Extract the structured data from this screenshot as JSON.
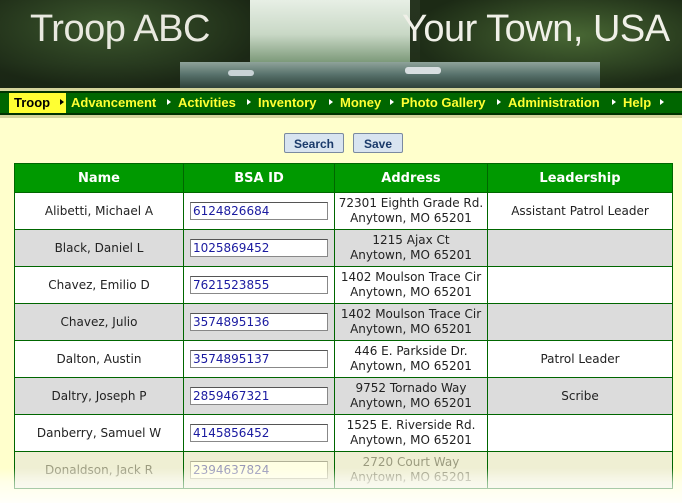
{
  "header": {
    "title_left": "Troop ABC",
    "title_right": "Your Town, USA"
  },
  "nav": {
    "items": [
      {
        "label": "Troop",
        "active": true
      },
      {
        "label": "Advancement",
        "active": false
      },
      {
        "label": "Activities",
        "active": false
      },
      {
        "label": "Inventory",
        "active": false
      },
      {
        "label": "Money",
        "active": false
      },
      {
        "label": "Photo Gallery",
        "active": false
      },
      {
        "label": "Administration",
        "active": false
      },
      {
        "label": "Help",
        "active": false
      }
    ]
  },
  "actions": {
    "search_label": "Search",
    "save_label": "Save"
  },
  "table": {
    "headers": [
      "Name",
      "BSA ID",
      "Address",
      "Leadership"
    ],
    "rows": [
      {
        "name": "Alibetti, Michael A",
        "bsa_id": "6124826684",
        "address_1": "72301 Eighth Grade Rd.",
        "address_2": "Anytown, MO 65201",
        "leadership": "Assistant Patrol Leader"
      },
      {
        "name": "Black, Daniel L",
        "bsa_id": "1025869452",
        "address_1": "1215 Ajax Ct",
        "address_2": "Anytown, MO 65201",
        "leadership": ""
      },
      {
        "name": "Chavez, Emilio D",
        "bsa_id": "7621523855",
        "address_1": "1402 Moulson Trace Cir",
        "address_2": "Anytown, MO 65201",
        "leadership": ""
      },
      {
        "name": "Chavez, Julio",
        "bsa_id": "3574895136",
        "address_1": "1402 Moulson Trace Cir",
        "address_2": "Anytown, MO 65201",
        "leadership": ""
      },
      {
        "name": "Dalton, Austin",
        "bsa_id": "3574895137",
        "address_1": "446 E. Parkside Dr.",
        "address_2": "Anytown, MO 65201",
        "leadership": "Patrol Leader"
      },
      {
        "name": "Daltry, Joseph P",
        "bsa_id": "2859467321",
        "address_1": "9752 Tornado Way",
        "address_2": "Anytown, MO 65201",
        "leadership": "Scribe"
      },
      {
        "name": "Danberry, Samuel W",
        "bsa_id": "4145856452",
        "address_1": "1525 E. Riverside Rd.",
        "address_2": "Anytown, MO 65201",
        "leadership": ""
      },
      {
        "name": "Donaldson, Jack R",
        "bsa_id": "2394637824",
        "address_1": "2720 Court Way",
        "address_2": "Anytown, MO 65201",
        "leadership": ""
      }
    ]
  },
  "colors": {
    "nav_bg": "#006600",
    "nav_text": "#ffff33",
    "header_row": "#009900",
    "page_bg": "#ffffcc",
    "alt_row": "#dcdcdc"
  }
}
